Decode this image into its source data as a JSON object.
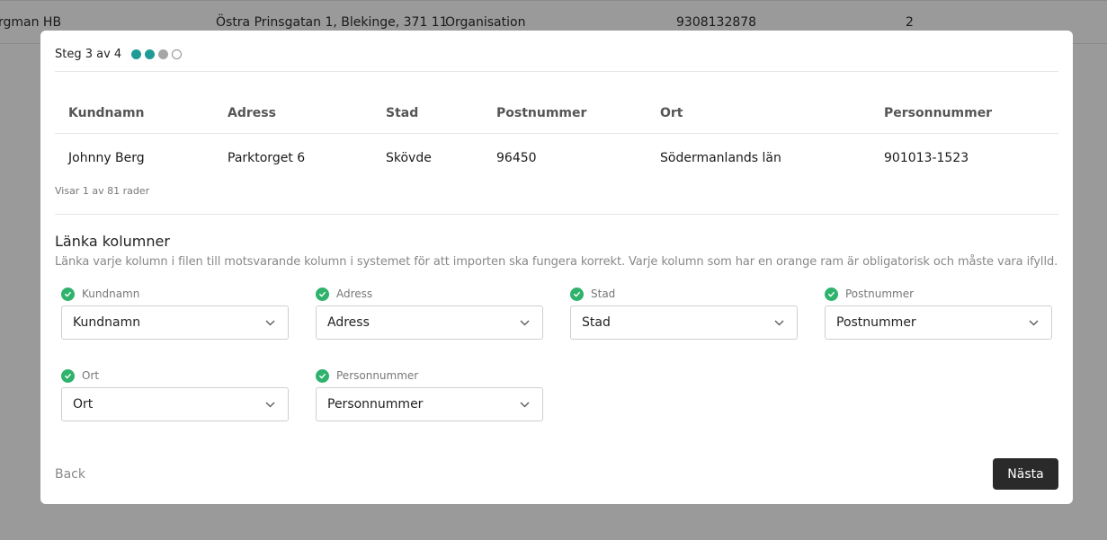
{
  "background_row": {
    "name": "rgman HB",
    "address": "Östra Prinsgatan 1, Blekinge, 371 11",
    "type": "Organisation",
    "number": "9308132878",
    "count": "2"
  },
  "modal": {
    "step_text": "Steg 3 av 4",
    "preview": {
      "headers": [
        "Kundnamn",
        "Adress",
        "Stad",
        "Postnummer",
        "Ort",
        "Personnummer"
      ],
      "rows": [
        [
          "Johnny Berg",
          "Parktorget 6",
          "Skövde",
          "96450",
          "Södermanlands län",
          "901013-1523"
        ]
      ],
      "rows_info": "Visar 1 av 81 rader"
    },
    "link": {
      "title": "Länka kolumner",
      "description": "Länka varje kolumn i filen till motsvarande kolumn i systemet för att importen ska fungera korrekt. Varje kolumn som har en orange ram är obligatorisk och måste vara ifylld.",
      "fields": [
        {
          "label": "Kundnamn",
          "value": "Kundnamn"
        },
        {
          "label": "Adress",
          "value": "Adress"
        },
        {
          "label": "Stad",
          "value": "Stad"
        },
        {
          "label": "Postnummer",
          "value": "Postnummer"
        },
        {
          "label": "Ort",
          "value": "Ort"
        },
        {
          "label": "Personnummer",
          "value": "Personnummer"
        }
      ]
    },
    "back_label": "Back",
    "next_label": "Nästa"
  },
  "colors": {
    "overlay": "#9a9a9a",
    "step_done": "#1e9b94",
    "check": "#2fb26c",
    "primary_button": "#2a2a2a"
  }
}
